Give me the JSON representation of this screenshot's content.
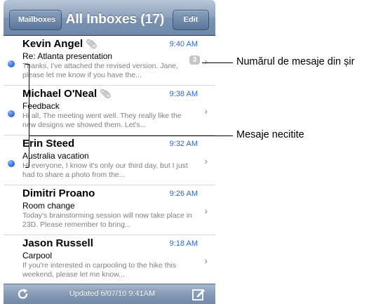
{
  "navbar": {
    "back_label": "Mailboxes",
    "title": "All Inboxes (17)",
    "edit_label": "Edit"
  },
  "messages": [
    {
      "sender": "Kevin Angel",
      "attachment": true,
      "time": "9:40 AM",
      "subject": "Re: Atlanta presentation",
      "preview": "Thanks, I've attached the revised version. Jane, please let me know if you have the...",
      "unread": true,
      "thread_count": "3"
    },
    {
      "sender": "Michael O'Neal",
      "attachment": true,
      "time": "9:38 AM",
      "subject": "Feedback",
      "preview": "Hi all, The meeting went well. They really like the new designs we showed them. Let's...",
      "unread": true
    },
    {
      "sender": "Erin Steed",
      "attachment": false,
      "time": "9:32 AM",
      "subject": "Australia vacation",
      "preview": "Hi everyone, I know it's only our third day, but I just had to share a photo from the...",
      "unread": true
    },
    {
      "sender": "Dimitri Proano",
      "attachment": false,
      "time": "9:26 AM",
      "subject": "Room change",
      "preview": "Today's brainstorming session will now take place in 23D. Please remember to bring...",
      "unread": false
    },
    {
      "sender": "Jason Russell",
      "attachment": false,
      "time": "9:18 AM",
      "subject": "Carpool",
      "preview": "If you're interested in carpooling to the hike this weekend, please let me know...",
      "unread": false
    }
  ],
  "toolbar": {
    "updated_text": "Updated 6/07/10 9:41AM",
    "refresh_icon": "refresh-icon",
    "compose_icon": "compose-icon"
  },
  "callouts": {
    "thread_count": "Numărul de mesaje din șir",
    "unread": "Mesaje necitite"
  },
  "colors": {
    "unread_dot": "#2c63d6",
    "time_text": "#2f66c8",
    "navbar": "#7d94b3"
  }
}
